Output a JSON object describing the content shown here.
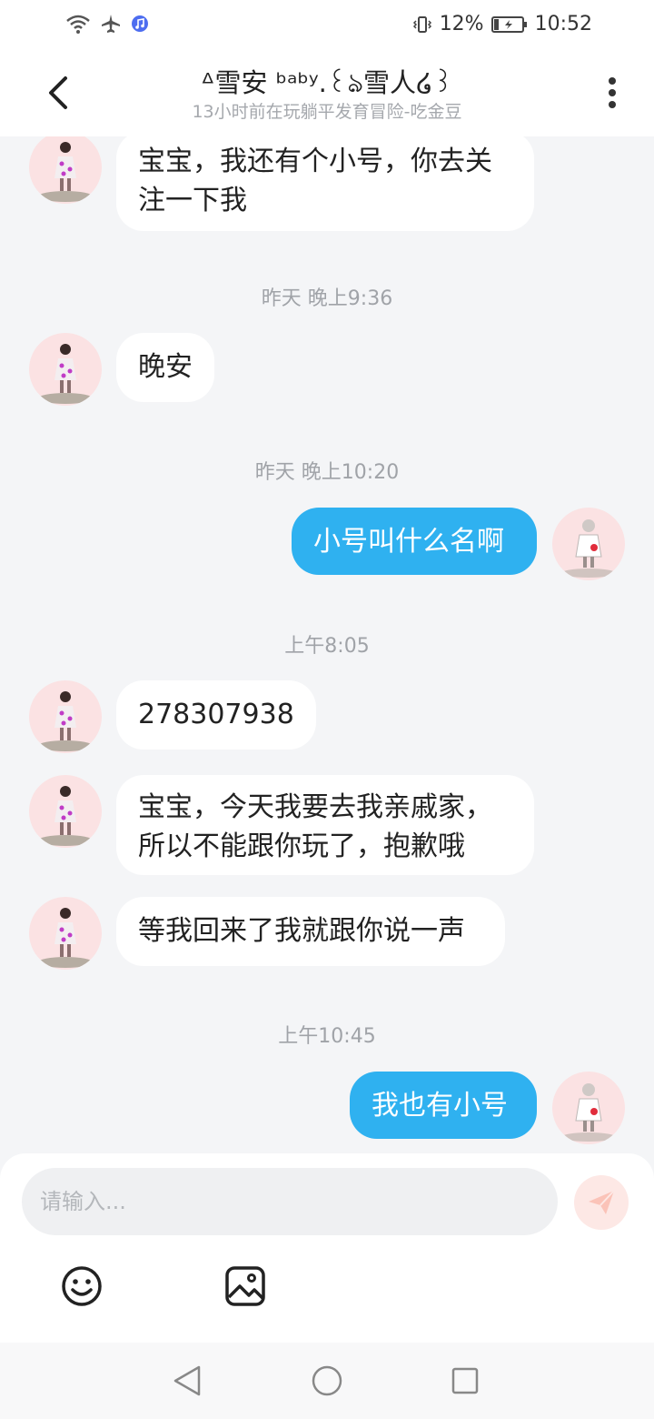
{
  "status_bar": {
    "battery": "12%",
    "time": "10:52"
  },
  "header": {
    "title": "ᐞ雪安 ᵇᵃᵇʸ.꒰ঌ雪人໒꒱",
    "subtitle": "13小时前在玩躺平发育冒险-吃金豆"
  },
  "messages": [
    {
      "side": "in",
      "text_lines": [
        "宝宝，我还有个小号，你去关",
        "注一下我"
      ]
    },
    {
      "timestamp": "昨天 晚上9:36"
    },
    {
      "side": "in",
      "text_lines": [
        "晚安"
      ]
    },
    {
      "timestamp": "昨天 晚上10:20"
    },
    {
      "side": "out",
      "text_lines": [
        "小号叫什么名啊"
      ]
    },
    {
      "timestamp": "上午8:05"
    },
    {
      "side": "in",
      "text_lines": [
        "278307938"
      ]
    },
    {
      "side": "in",
      "text_lines": [
        "宝宝，今天我要去我亲戚家，",
        "所以不能跟你玩了，抱歉哦"
      ]
    },
    {
      "side": "in",
      "text_lines": [
        "等我回来了我就跟你说一声"
      ]
    },
    {
      "timestamp": "上午10:45"
    },
    {
      "side": "out",
      "text_lines": [
        "我也有小号"
      ]
    }
  ],
  "composer": {
    "placeholder": "请输入..."
  },
  "icons": {
    "back": "chevron-left-icon",
    "more": "more-vertical-icon",
    "send": "paper-plane-icon",
    "emoji": "smiley-icon",
    "image": "image-icon"
  },
  "colors": {
    "outgoing_bubble": "#2fb1f0",
    "incoming_bubble": "#ffffff",
    "background": "#f4f5f7",
    "avatar_bg": "#fbe2e3"
  }
}
